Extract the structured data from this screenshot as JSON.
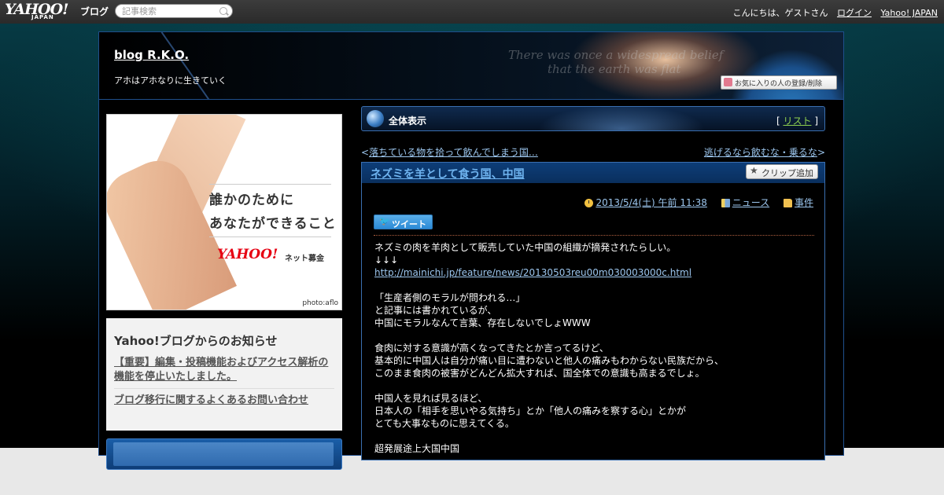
{
  "topbar": {
    "logo_text": "YAHOO!",
    "logo_sub": "JAPAN",
    "logo_blog": "ブログ",
    "search_placeholder": "記事検索",
    "greeting": "こんにちは、ゲストさん",
    "login": "ログイン",
    "yahoo_japan": "Yahoo! JAPAN"
  },
  "header": {
    "blog_title": "blog R.K.O.",
    "description": "アホはアホなりに生きていく",
    "bg_text_line1": "There was once a widespread belief",
    "bg_text_line2": "that the earth was flat",
    "favorite_button": "お気に入りの人の登録/削除"
  },
  "ad": {
    "line1": "誰かのために",
    "line2": "あなたができること",
    "logo": "YAHOO!",
    "logo_sub": "ネット募金",
    "credit": "photo:aflo"
  },
  "notice": {
    "heading": "Yahoo!ブログからのお知らせ",
    "links": [
      "【重要】編集・投稿機能およびアクセス解析の機能を停止いたしました。",
      "ブログ移行に関するよくあるお問い合わせ"
    ]
  },
  "all_view": {
    "label": "全体表示",
    "list_open": "[",
    "list_link": "リスト",
    "list_close": "]"
  },
  "nav": {
    "prev_arrow": "<",
    "prev": "落ちている物を拾って飲んでしまう国…",
    "next": "逃げるなら飲むな・乗るな",
    "next_arrow": ">"
  },
  "article": {
    "title": "ネズミを羊として食う国、中国",
    "clip_button": "クリップ追加",
    "date": "2013/5/4(土) 午前 11:38",
    "category1": "ニュース",
    "category2": "事件",
    "tweet": "ツイート",
    "body_lines": [
      "ネズミの肉を羊肉として販売していた中国の組織が摘発されたらしい。",
      "↓↓↓",
      "",
      "",
      "「生産者側のモラルが問われる…」",
      "と記事には書かれているが、",
      "中国にモラルなんて言葉、存在しないでしょWWW",
      "",
      "食肉に対する意識が高くなってきたとか言ってるけど、",
      "基本的に中国人は自分が痛い目に遭わないと他人の痛みもわからない民族だから、",
      "このまま食肉の被害がどんどん拡大すれば、国全体での意識も高まるでしょ。",
      "",
      "中国人を見れば見るほど、",
      "日本人の「相手を思いやる気持ち」とか「他人の痛みを察する心」とかが",
      "とても大事なものに思えてくる。",
      "",
      "超発展途上大国中国"
    ],
    "link": "http://mainichi.jp/feature/news/20130503reu00m030003000c.html"
  }
}
